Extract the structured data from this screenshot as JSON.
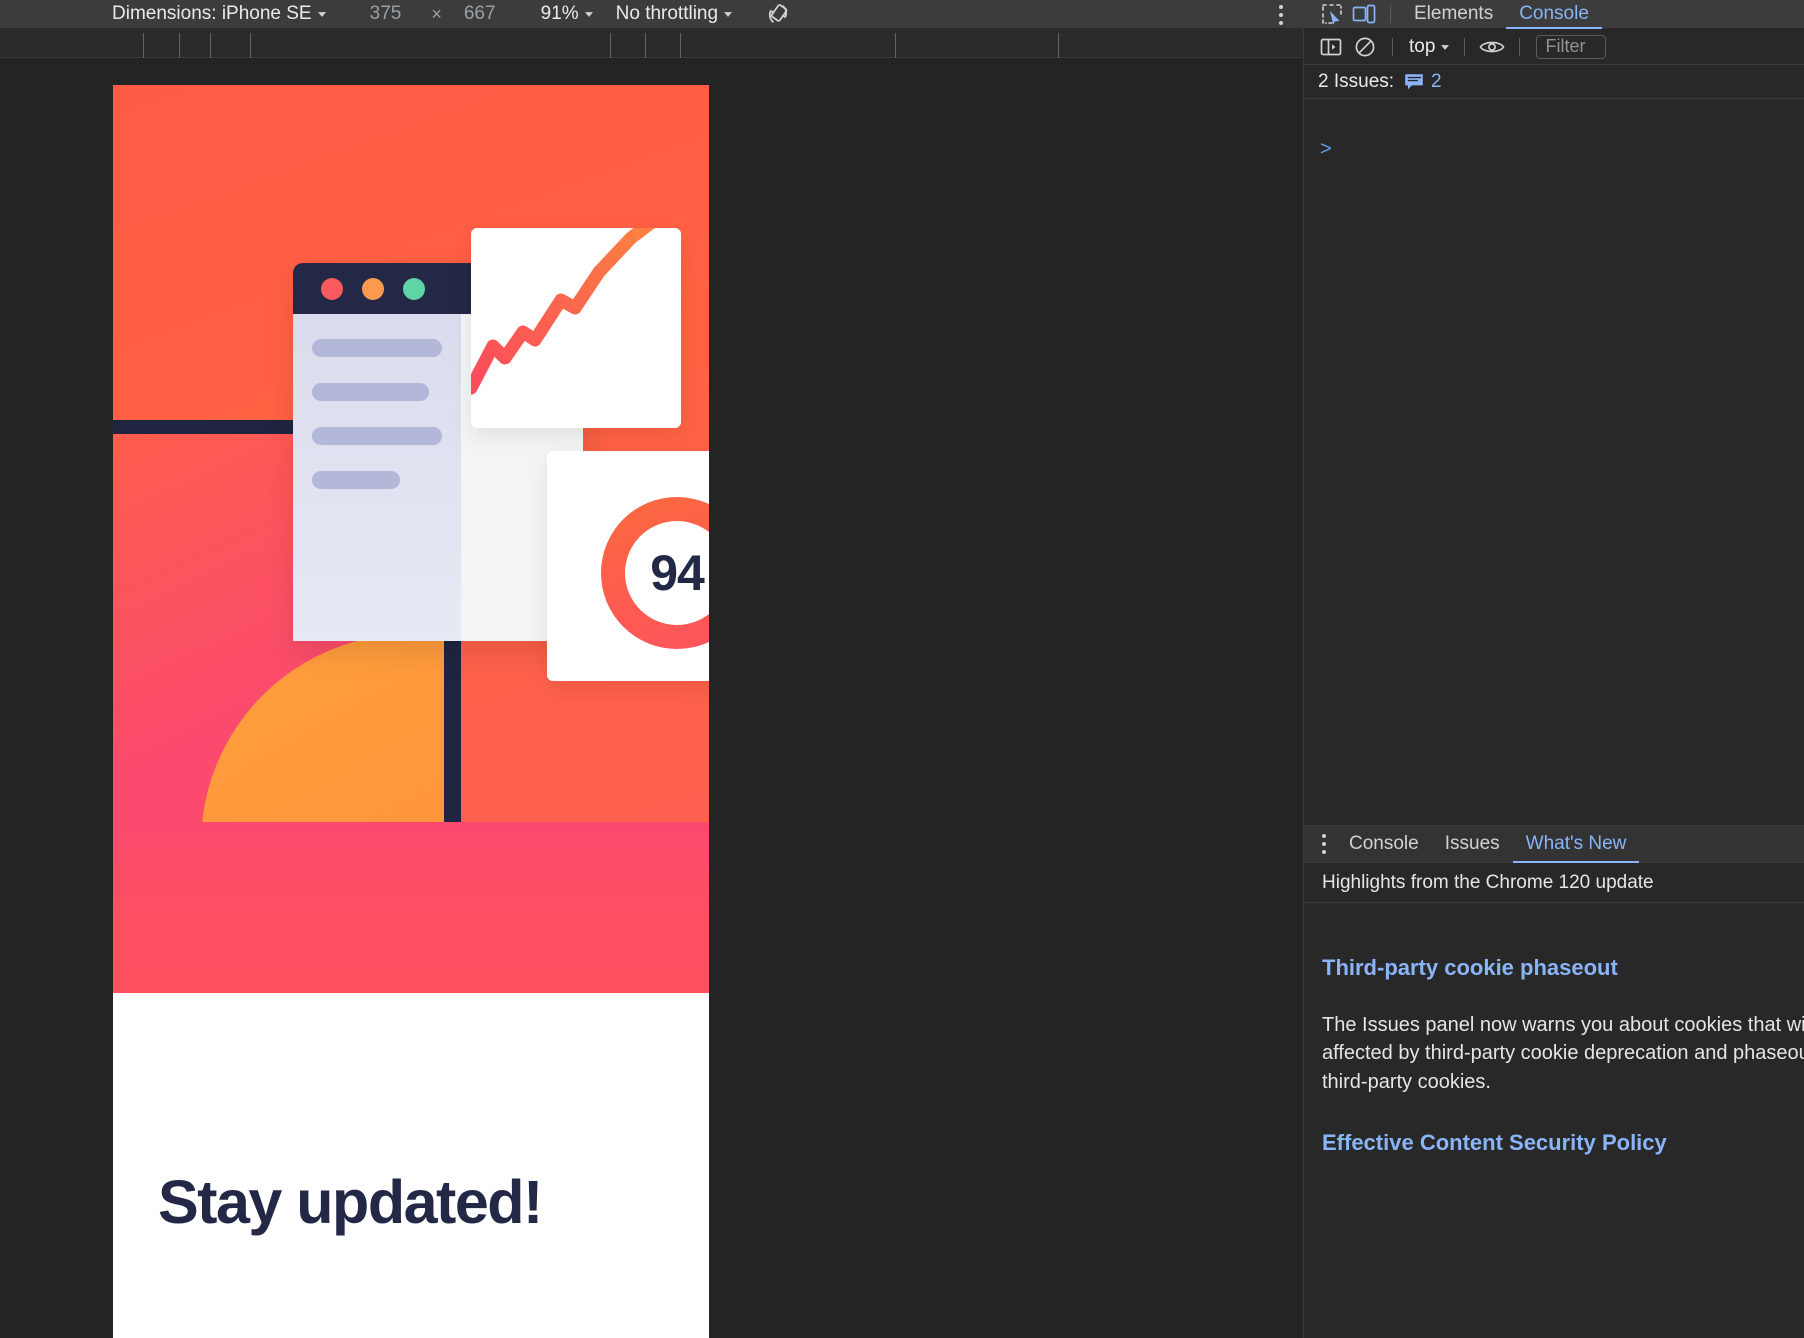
{
  "device_toolbar": {
    "dimensions_label": "Dimensions: iPhone SE",
    "width": "375",
    "times": "×",
    "height": "667",
    "zoom": "91%",
    "throttling": "No throttling",
    "rotate_icon": "rotate-device-icon",
    "more_icon": "more-options-kebab-icon",
    "caret": "▾"
  },
  "viewport": {
    "headline": "Stay updated!",
    "score_value": "94",
    "window_dots": [
      "red",
      "amber",
      "green"
    ],
    "colors": {
      "orange": "#ff6242",
      "pink": "#fb4a6e",
      "navy": "#222846",
      "accent_ring_start": "#fa6a3c",
      "accent_ring_end": "#fe5260",
      "sidebar_skeleton": "#b4b8d8"
    }
  },
  "devtools": {
    "inspect_icon": "inspect-element-icon",
    "device_toggle_icon": "toggle-device-toolbar-icon",
    "main_tabs": [
      {
        "label": "Elements",
        "active": false
      },
      {
        "label": "Console",
        "active": true
      }
    ],
    "console_toolbar": {
      "sidebar_icon": "show-console-sidebar-icon",
      "clear_icon": "clear-console-icon",
      "context": "top",
      "context_caret": "▾",
      "eye_icon": "live-expression-eye-icon",
      "filter_placeholder": "Filter"
    },
    "issues_bar": {
      "label": "2 Issues:",
      "badge_icon": "issue-message-icon",
      "badge_count": "2"
    },
    "console_prompt": ">",
    "drawer": {
      "kebab_icon": "drawer-more-tabs-icon",
      "tabs": [
        {
          "label": "Console",
          "active": false
        },
        {
          "label": "Issues",
          "active": false
        },
        {
          "label": "What's New",
          "active": true
        }
      ],
      "subtitle": "Highlights from the Chrome 120 update",
      "articles": [
        {
          "heading": "Third-party cookie phaseout",
          "body": "The Issues panel now warns you about cookies that will be affected by third-party cookie deprecation and phaseout of third-party cookies."
        },
        {
          "heading": "Effective Content Security Policy",
          "body": ""
        }
      ]
    },
    "accent_color": "#8ab4f8"
  }
}
